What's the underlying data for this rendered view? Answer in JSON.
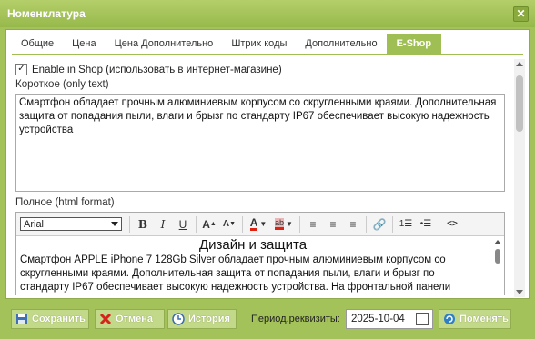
{
  "window": {
    "title": "Номенклатура"
  },
  "tabs": [
    {
      "label": "Общие"
    },
    {
      "label": "Цена"
    },
    {
      "label": "Цена Дополнительно"
    },
    {
      "label": "Штрих коды"
    },
    {
      "label": "Дополнительно"
    },
    {
      "label": "E-Shop"
    }
  ],
  "shop": {
    "enable_label": "Enable in Shop (использовать в интернет-магазине)",
    "enabled": true,
    "short_label": "Короткое (only text)",
    "short_text": "Смартфон обладает прочным алюминиевым корпусом со скругленными краями. Дополнительная защита от попадания пыли, влаги и брызг по стандарту IP67 обеспечивает высокую надежность устройства",
    "full_label": "Полное (html format)",
    "font": "Arial",
    "full_heading": "Дизайн и защита",
    "full_text": "Смартфон APPLE iPhone 7 128Gb Silver обладает прочным алюминиевым корпусом со скругленными краями. Дополнительная защита от попадания пыли, влаги и брызг по стандарту IP67 обеспечивает высокую надежность устройства. На фронтальной панели расположена кнопка «Домой» с датчиком Touch ID"
  },
  "toolbar_icons": [
    "bold-icon",
    "italic-icon",
    "underline-icon",
    "font-size-up-icon",
    "font-size-down-icon",
    "font-color-icon",
    "highlight-color-icon",
    "align-left-icon",
    "align-center-icon",
    "align-right-icon",
    "link-icon",
    "ordered-list-icon",
    "unordered-list-icon",
    "source-code-icon"
  ],
  "bottom": {
    "save": "Сохранить",
    "cancel": "Отмена",
    "history": "История",
    "period_label": "Период.реквизиты:",
    "date": "2025-10-04",
    "change": "Поменять"
  },
  "colors": {
    "accent": "#a4c25a",
    "tab_active": "#9fbf55",
    "button": "#c3d98a"
  }
}
